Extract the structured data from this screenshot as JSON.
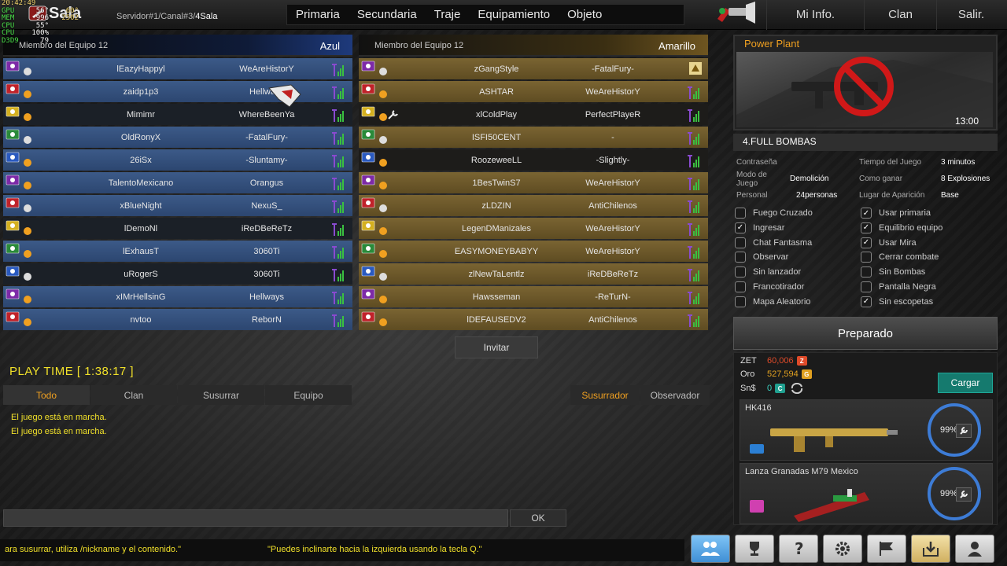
{
  "overlay": {
    "time": "20:42:49",
    "rows": [
      {
        "k": "GPU",
        "v": "56°",
        "v2": "60°"
      },
      {
        "k": "MEM",
        "v": "996",
        "v2": "2502"
      },
      {
        "k": "CPU",
        "v": "55°",
        "v2": ""
      },
      {
        "k": "CPU",
        "v": "100%",
        "v2": ""
      },
      {
        "k": "D3D9",
        "v": "79",
        "v2": ""
      }
    ]
  },
  "header": {
    "title": "Sala",
    "breadcrumb": "Servidor#1/Canal#3/",
    "room": "4Sala",
    "nav": [
      "Primaria",
      "Secundaria",
      "Traje",
      "Equipamiento",
      "Objeto"
    ],
    "right_nav": [
      "Mi Info.",
      "Clan",
      "Salir."
    ]
  },
  "teams": {
    "blue": {
      "members": "Miembro del Equipo 12",
      "name": "Azul",
      "players": [
        {
          "name": "lEazyHappyl",
          "clan": "WeAreHistorY"
        },
        {
          "name": "zaidp1p3",
          "clan": "Hellways"
        },
        {
          "name": "Mimimr",
          "clan": "WhereBeenYa"
        },
        {
          "name": "OldRonyX",
          "clan": "-FatalFury-"
        },
        {
          "name": "26iSx",
          "clan": "-Sluntamy-"
        },
        {
          "name": "TalentoMexicano",
          "clan": "Orangus"
        },
        {
          "name": "xBlueNight",
          "clan": "NexuS_"
        },
        {
          "name": "lDemoNl",
          "clan": "iReDBeReTz"
        },
        {
          "name": "lExhausT",
          "clan": "3060Ti"
        },
        {
          "name": "uRogerS",
          "clan": "3060Ti"
        },
        {
          "name": "xIMrHellsinG",
          "clan": "Hellways"
        },
        {
          "name": "nvtoo",
          "clan": "ReborN"
        }
      ]
    },
    "yellow": {
      "members": "Miembro del Equipo 12",
      "name": "Amarillo",
      "players": [
        {
          "name": "zGangStyle",
          "clan": "-FatalFury-"
        },
        {
          "name": "ASHTAR",
          "clan": "WeAreHistorY"
        },
        {
          "name": "xlColdPlay",
          "clan": "PerfectPlayeR"
        },
        {
          "name": "ISFI50CENT",
          "clan": "-"
        },
        {
          "name": "RoozeweeLL",
          "clan": "-Slightly-"
        },
        {
          "name": "1BesTwinS7",
          "clan": "WeAreHistorY"
        },
        {
          "name": "zLDZIN",
          "clan": "AntiChilenos"
        },
        {
          "name": "LegenDManizales",
          "clan": "WeAreHistorY"
        },
        {
          "name": "EASYMONEYBABYY",
          "clan": "WeAreHistorY"
        },
        {
          "name": "zlNewTaLentlz",
          "clan": "iReDBeReTz"
        },
        {
          "name": "Hawsseman",
          "clan": "-ReTurN-"
        },
        {
          "name": "lDEFAUSEDV2",
          "clan": "AntiChilenos"
        }
      ]
    }
  },
  "invite_label": "Invitar",
  "chat": {
    "playtime": "PLAY TIME [ 1:38:17 ]",
    "tabs": [
      "Todo",
      "Clan",
      "Susurrar",
      "Equipo"
    ],
    "tabs_right": [
      "Susurrador",
      "Observador"
    ],
    "log": [
      "El juego está en marcha.",
      "El juego está en marcha."
    ],
    "input_value": "",
    "ok_label": "OK",
    "ticker1": "ara susurrar, utiliza /nickname y el contenido.\"",
    "ticker2": "\"Puedes inclinarte hacia la izquierda usando la tecla Q.\""
  },
  "room": {
    "map_name": "Power Plant",
    "map_time": "13:00",
    "mode": "4.FULL BOMBAS",
    "info": [
      {
        "k": "Contraseña",
        "v": "",
        "k2": "Tiempo del Juego",
        "v2": "3 minutos"
      },
      {
        "k": "Modo de Juego",
        "v": "Demolición",
        "k2": "Como ganar",
        "v2": "8 Explosiones"
      },
      {
        "k": "Personal",
        "v": "24personas",
        "k2": "Lugar de Aparición",
        "v2": "Base"
      }
    ],
    "options_left": [
      {
        "label": "Fuego Cruzado",
        "checked": false
      },
      {
        "label": "Ingresar",
        "checked": true
      },
      {
        "label": "Chat Fantasma",
        "checked": false
      },
      {
        "label": "Observar",
        "checked": false
      },
      {
        "label": "Sin lanzador",
        "checked": false
      },
      {
        "label": "Francotirador",
        "checked": false
      },
      {
        "label": "Mapa Aleatorio",
        "checked": false
      }
    ],
    "options_right": [
      {
        "label": "Usar primaria",
        "checked": true
      },
      {
        "label": "Equilibrio equipo",
        "checked": true
      },
      {
        "label": "Usar Mira",
        "checked": true
      },
      {
        "label": "Cerrar combate",
        "checked": false
      },
      {
        "label": "Sin Bombas",
        "checked": false
      },
      {
        "label": "Pantalla Negra",
        "checked": false
      },
      {
        "label": "Sin escopetas",
        "checked": true
      }
    ],
    "ready_label": "Preparado"
  },
  "wallet": {
    "zet_label": "ZET",
    "zet_value": "60,006",
    "oro_label": "Oro",
    "oro_value": "527,594",
    "sn_label": "Sn$",
    "sn_value": "0",
    "load_label": "Cargar",
    "colors": {
      "zet": "#e04b2a",
      "oro": "#e0a020",
      "sn": "#3ad0c0"
    }
  },
  "weapons": [
    {
      "name": "HK416",
      "durability": "99%"
    },
    {
      "name": "Lanza Granadas M79 Mexico",
      "durability": "99%"
    }
  ],
  "bottom_icons": [
    "friends-icon",
    "trophy-icon",
    "help-icon",
    "settings-icon",
    "flag-icon",
    "inventory-icon",
    "profile-icon"
  ]
}
